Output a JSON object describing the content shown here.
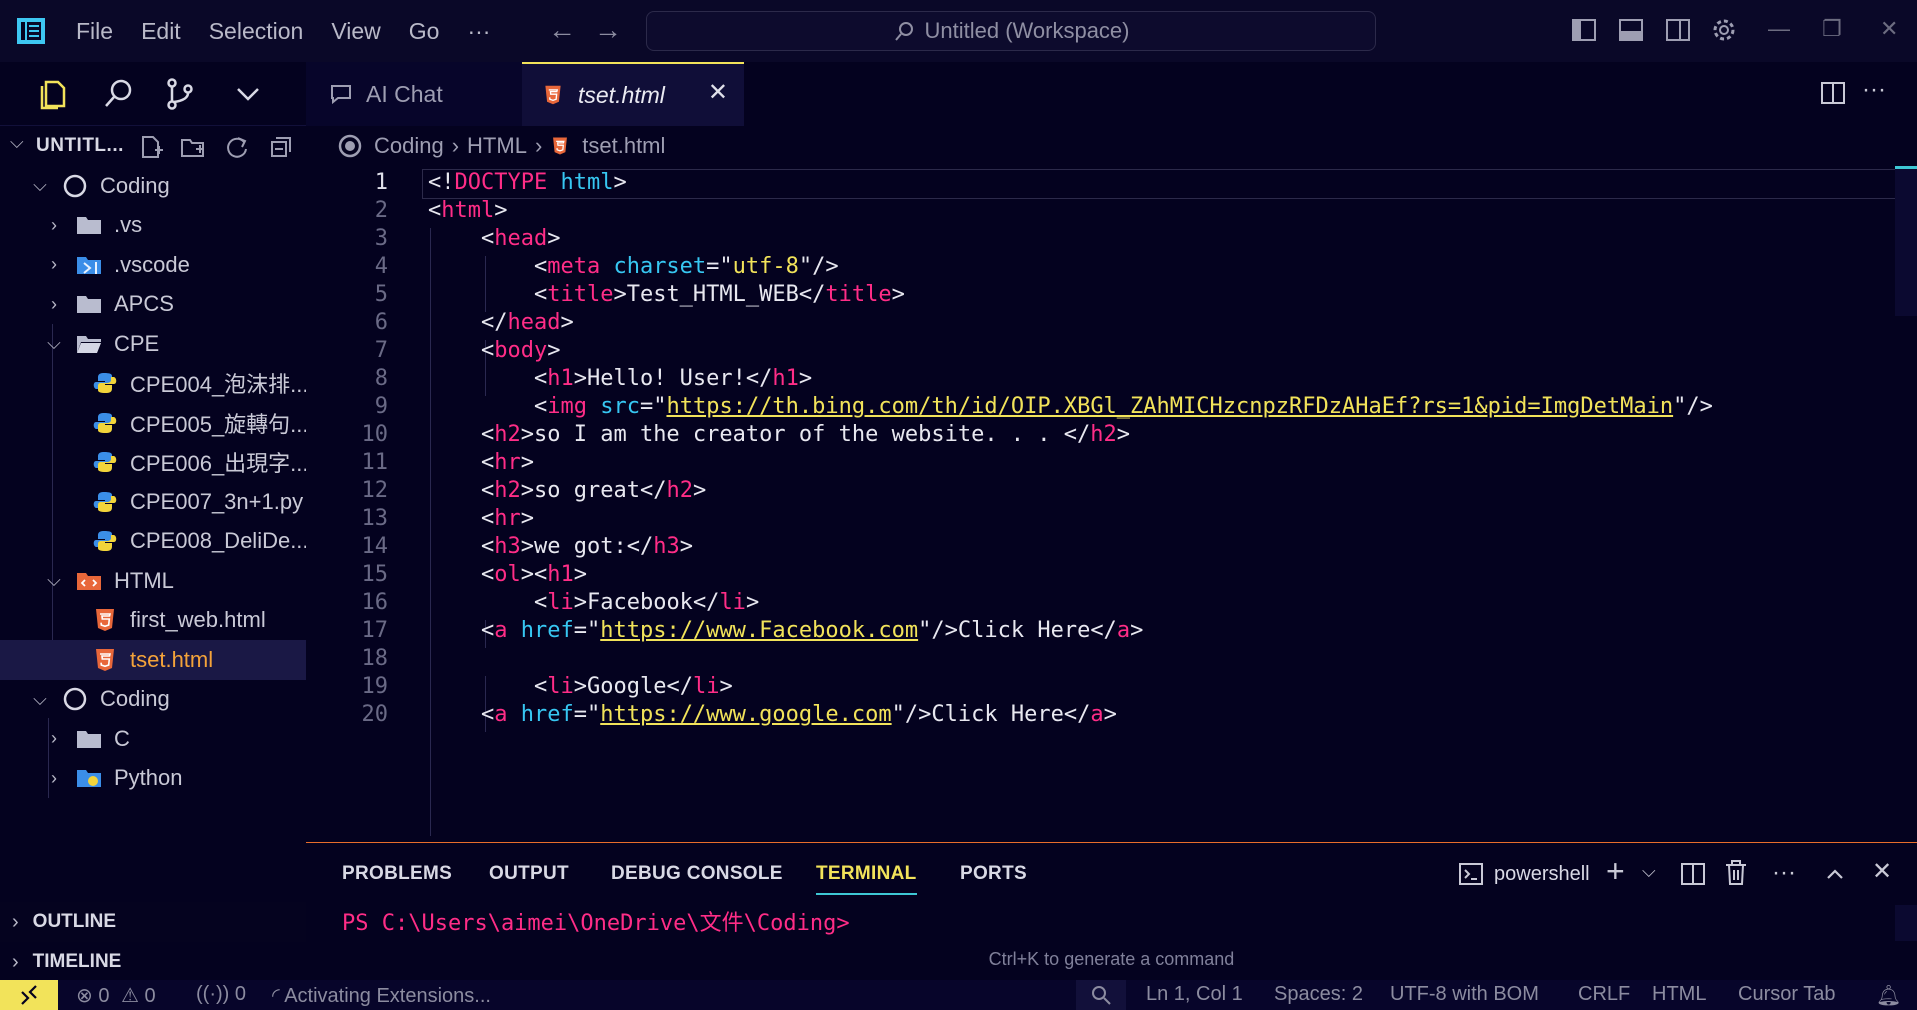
{
  "menu": [
    "File",
    "Edit",
    "Selection",
    "View",
    "Go"
  ],
  "menu_more": "···",
  "command_center": "Untitled (Workspace)",
  "explorer": {
    "title": "UNTITL...",
    "tree": [
      {
        "label": "Coding",
        "type": "root",
        "expanded": true
      },
      {
        "label": ".vs",
        "type": "folder"
      },
      {
        "label": ".vscode",
        "type": "folder-vscode"
      },
      {
        "label": "APCS",
        "type": "folder"
      },
      {
        "label": "CPE",
        "type": "folder-open",
        "expanded": true
      },
      {
        "label": "CPE004_泡沫排...",
        "type": "python"
      },
      {
        "label": "CPE005_旋轉句...",
        "type": "python"
      },
      {
        "label": "CPE006_出現字...",
        "type": "python"
      },
      {
        "label": "CPE007_3n+1.py",
        "type": "python"
      },
      {
        "label": "CPE008_DeliDe...",
        "type": "python"
      },
      {
        "label": "HTML",
        "type": "folder-html",
        "expanded": true
      },
      {
        "label": "first_web.html",
        "type": "html"
      },
      {
        "label": "tset.html",
        "type": "html",
        "selected": true
      },
      {
        "label": "Coding",
        "type": "root",
        "expanded": true
      },
      {
        "label": "C",
        "type": "folder"
      },
      {
        "label": "Python",
        "type": "folder-python"
      }
    ],
    "outline": "OUTLINE",
    "timeline": "TIMELINE"
  },
  "tabs": [
    {
      "label": "AI Chat"
    },
    {
      "label": "tset.html",
      "active": true
    }
  ],
  "breadcrumb": [
    "Coding",
    "HTML",
    "tset.html"
  ],
  "code_lines": [
    "1",
    "2",
    "3",
    "4",
    "5",
    "6",
    "7",
    "8",
    "9",
    "10",
    "11",
    "12",
    "13",
    "14",
    "15",
    "16",
    "17",
    "18",
    "19",
    "20"
  ],
  "code": {
    "title_text": "Test_HTML_WEB",
    "charset": "utf-8",
    "h1": "Hello! User!",
    "img_src": "https://th.bing.com/th/id/OIP.XBGl_ZAhMICHzcnpzRFDzAHaEf?rs=1&pid=ImgDetMain",
    "h2a": "so I am the creator of the website. . . ",
    "h2b": "so great",
    "h3": "we got:",
    "li1": "Facebook",
    "href1": "https://www.Facebook.com",
    "click": "Click Here",
    "li2": "Google",
    "href2": "https://www.google.com"
  },
  "panel": {
    "tabs": [
      "PROBLEMS",
      "OUTPUT",
      "DEBUG CONSOLE",
      "TERMINAL",
      "PORTS"
    ],
    "active_tab": "TERMINAL",
    "shell": "powershell",
    "prompt": "PS C:\\Users\\aimei\\OneDrive\\文件\\Coding>",
    "hint": "Ctrl+K to generate a command"
  },
  "status": {
    "errors": "0",
    "warnings": "0",
    "ports": "0",
    "activity": "Activating Extensions...",
    "position": "Ln 1, Col 1",
    "spaces": "Spaces: 2",
    "encoding": "UTF-8 with BOM",
    "eol": "CRLF",
    "language": "HTML",
    "cursor_tab": "Cursor Tab"
  },
  "colors": {
    "accent": "#f2e35a",
    "tag": "#ff2d87",
    "attr": "#37c7f2",
    "background": "#04021f"
  }
}
